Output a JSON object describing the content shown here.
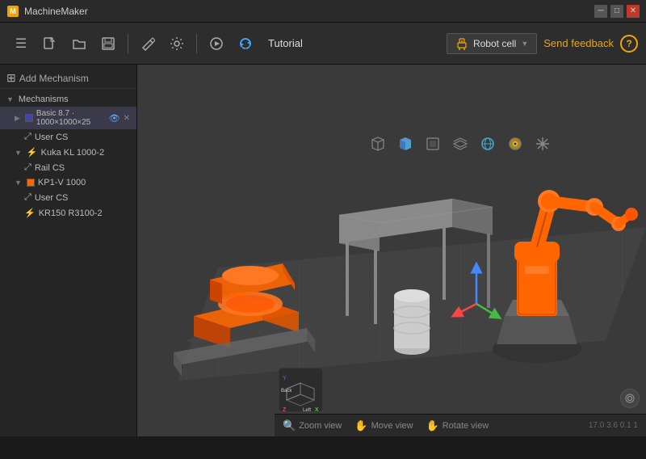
{
  "app": {
    "title": "MachineMaker",
    "toolbar_title": "Tutorial"
  },
  "toolbar": {
    "buttons": [
      "☰",
      "📄",
      "📁",
      "💾",
      "✂",
      "⚙",
      "▶",
      "↻"
    ],
    "robot_cell_label": "Robot cell",
    "send_feedback_label": "Send feedback",
    "help_label": "?"
  },
  "view_toolbar": {
    "buttons": [
      "cube_outline",
      "cube_solid",
      "cube_face",
      "layers",
      "sphere",
      "eye_circle",
      "scissors_cross"
    ]
  },
  "sidebar": {
    "add_mechanism_label": "Add Mechanism",
    "mechanisms_label": "Mechanisms",
    "items": [
      {
        "id": "basic87",
        "label": "Basic 8.7 · 1000×1000×25",
        "level": 2,
        "has_color": true,
        "color": "#4444aa",
        "has_eye": true,
        "has_close": true,
        "expanded": false
      },
      {
        "id": "user_cs_1",
        "label": "User CS",
        "level": 3,
        "icon": "⤢"
      },
      {
        "id": "kuka_kl",
        "label": "Kuka KL 1000-2",
        "level": 2,
        "icon": "⚡",
        "expanded": true
      },
      {
        "id": "rail_cs",
        "label": "Rail CS",
        "level": 3,
        "icon": "⤢"
      },
      {
        "id": "kp1v",
        "label": "KP1-V 1000",
        "level": 2,
        "expanded": true,
        "has_color": true,
        "color": "#ff6600"
      },
      {
        "id": "user_cs_2",
        "label": "User CS",
        "level": 3,
        "icon": "⤢"
      },
      {
        "id": "kr150",
        "label": "KR150 R3100-2",
        "level": 3,
        "icon": "⚡"
      }
    ]
  },
  "statusbar": {
    "zoom_label": "Zoom view",
    "move_label": "Move view",
    "rotate_label": "Rotate view",
    "coords": "17.0 3.6 0.1 1"
  },
  "axes": {
    "back_label": "Back",
    "left_label": "Left"
  }
}
